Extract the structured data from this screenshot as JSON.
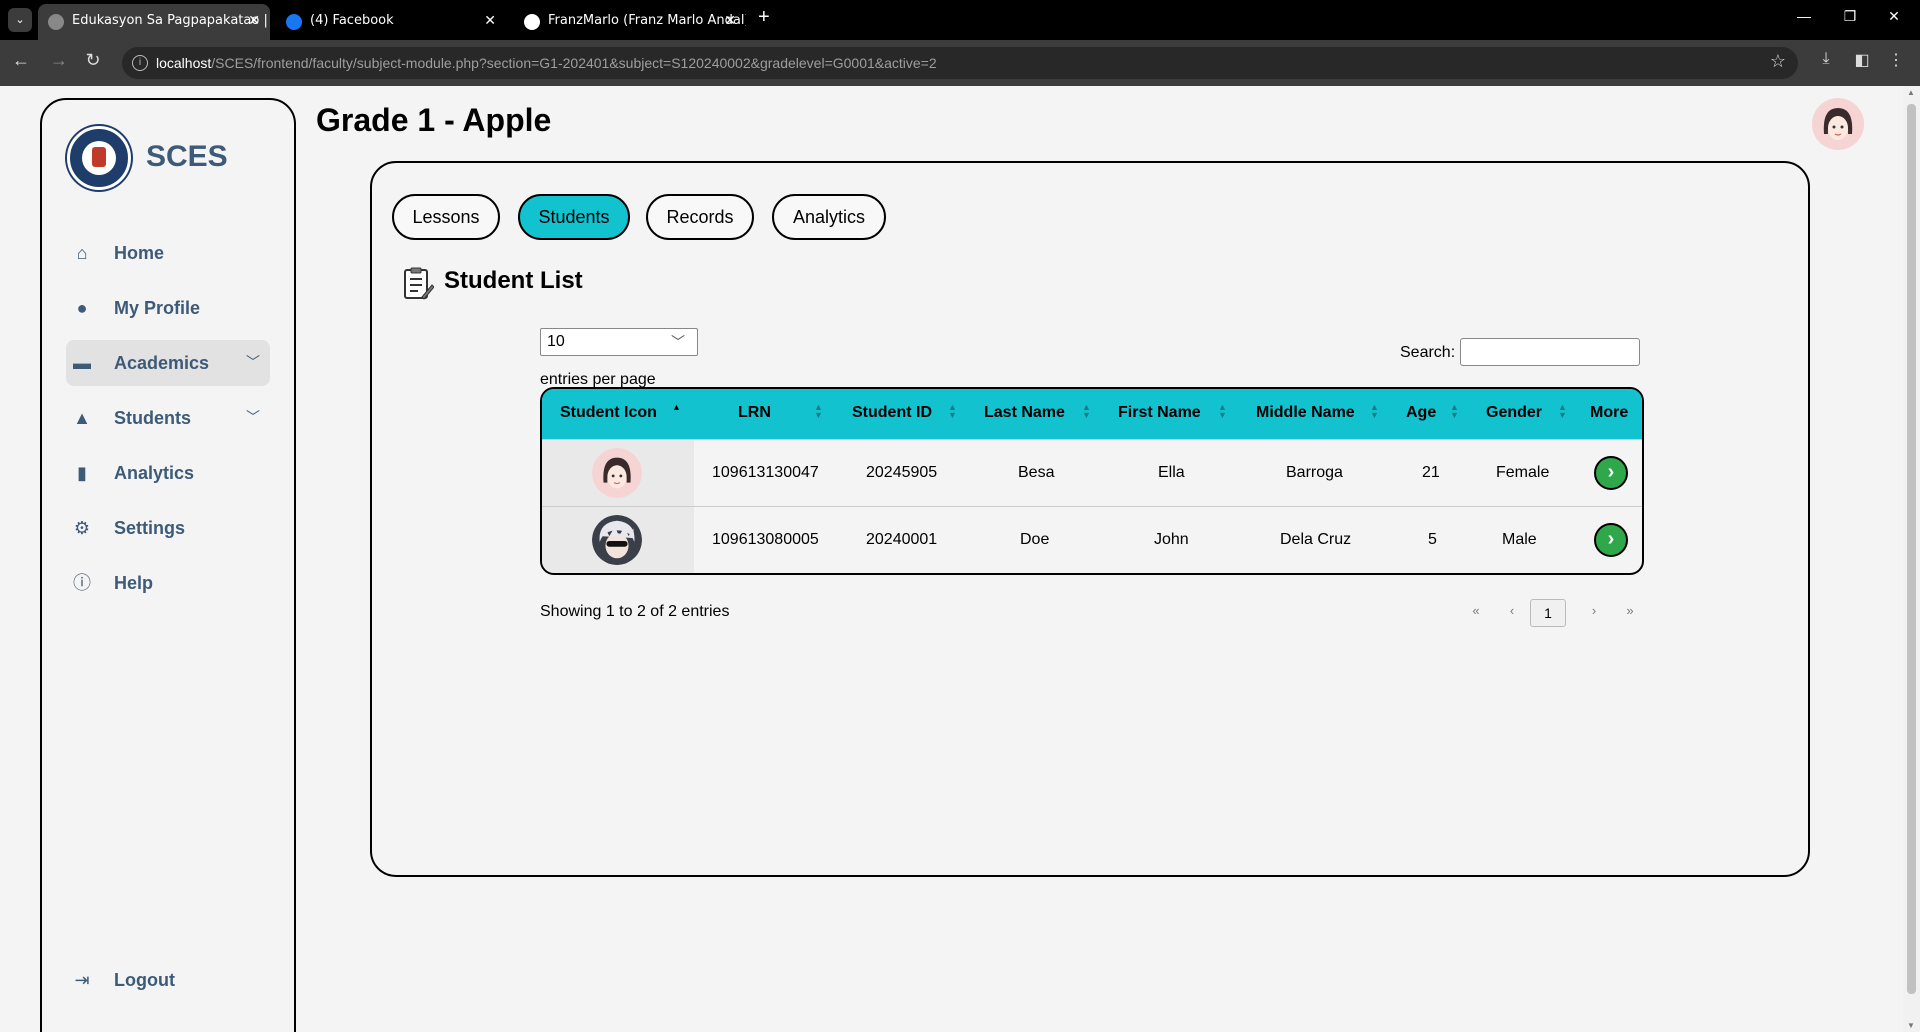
{
  "browser": {
    "tabs": [
      {
        "title": "Edukasyon Sa Pagpapakatao | S",
        "active": true
      },
      {
        "title": "(4) Facebook",
        "active": false
      },
      {
        "title": "FranzMarlo (Franz Marlo Andal)",
        "active": false
      }
    ],
    "url_host": "localhost",
    "url_path": "/SCES/frontend/faculty/subject-module.php?section=G1-202401&subject=S120240002&gradelevel=G0001&active=2"
  },
  "sidebar": {
    "brand": "SCES",
    "items": [
      {
        "label": "Home",
        "icon": "home-icon"
      },
      {
        "label": "My Profile",
        "icon": "user-icon"
      },
      {
        "label": "Academics",
        "icon": "briefcase-icon"
      },
      {
        "label": "Students",
        "icon": "student-icon"
      },
      {
        "label": "Analytics",
        "icon": "bar-chart-icon"
      },
      {
        "label": "Settings",
        "icon": "gear-icon"
      },
      {
        "label": "Help",
        "icon": "info-icon"
      }
    ],
    "logout": "Logout"
  },
  "page": {
    "title": "Grade 1 - Apple"
  },
  "tabs": [
    "Lessons",
    "Students",
    "Records",
    "Analytics"
  ],
  "student_list": {
    "title": "Student List",
    "entries_value": "10",
    "entries_label": "entries per page",
    "search_label": "Search:",
    "columns": [
      "Student Icon",
      "LRN",
      "Student ID",
      "Last Name",
      "First Name",
      "Middle Name",
      "Age",
      "Gender",
      "More"
    ],
    "rows": [
      {
        "lrn": "109613130047",
        "student_id": "20245905",
        "last": "Besa",
        "first": "Ella",
        "middle": "Barroga",
        "age": "21",
        "gender": "Female"
      },
      {
        "lrn": "109613080005",
        "student_id": "20240001",
        "last": "Doe",
        "first": "John",
        "middle": "Dela Cruz",
        "age": "5",
        "gender": "Male"
      }
    ],
    "showing": "Showing 1 to 2 of 2 entries",
    "pagination": {
      "first": "«",
      "prev": "‹",
      "current": "1",
      "next": "›",
      "last": "»"
    }
  },
  "colors": {
    "accent": "#12c2cf",
    "nav_text": "#3d5a78",
    "more_button": "#2ea84a"
  }
}
